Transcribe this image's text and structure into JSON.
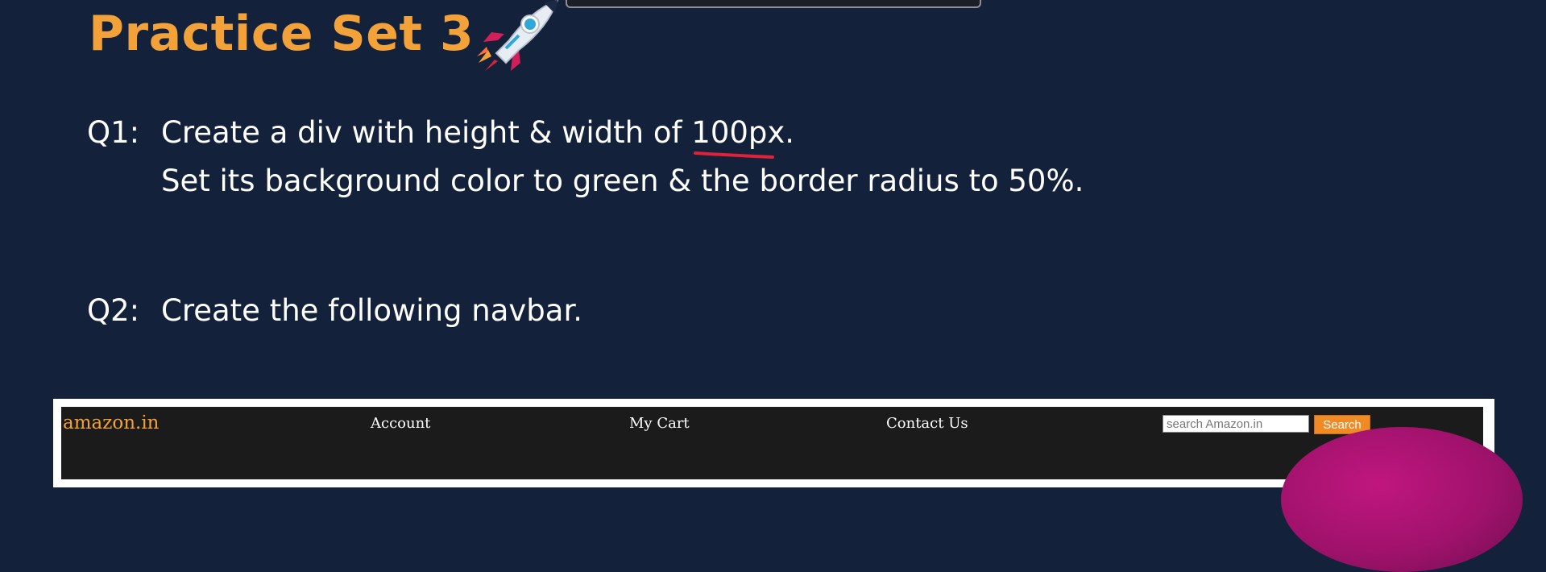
{
  "slide": {
    "title": "Practice Set 3",
    "title_color": "#f3a239",
    "background_color": "#13213b",
    "decoration_icon": "rocket-icon"
  },
  "questions": [
    {
      "label": "Q1:",
      "lines": [
        "Create a div with height & width of 100px.",
        "Set its background color to green & the border radius to 50%."
      ]
    },
    {
      "label": "Q2:",
      "lines": [
        "Create the following navbar."
      ]
    }
  ],
  "annotation": {
    "underline_color": "#e0213a",
    "underlined_text": "100px"
  },
  "navbar": {
    "logo": "amazon.in",
    "logo_color": "#f3a239",
    "links": [
      "Account",
      "My Cart",
      "Contact Us"
    ],
    "search_placeholder": "search Amazon.in",
    "search_button": "Search",
    "search_button_color": "#f08a24",
    "background_color": "#1b1b1b"
  }
}
